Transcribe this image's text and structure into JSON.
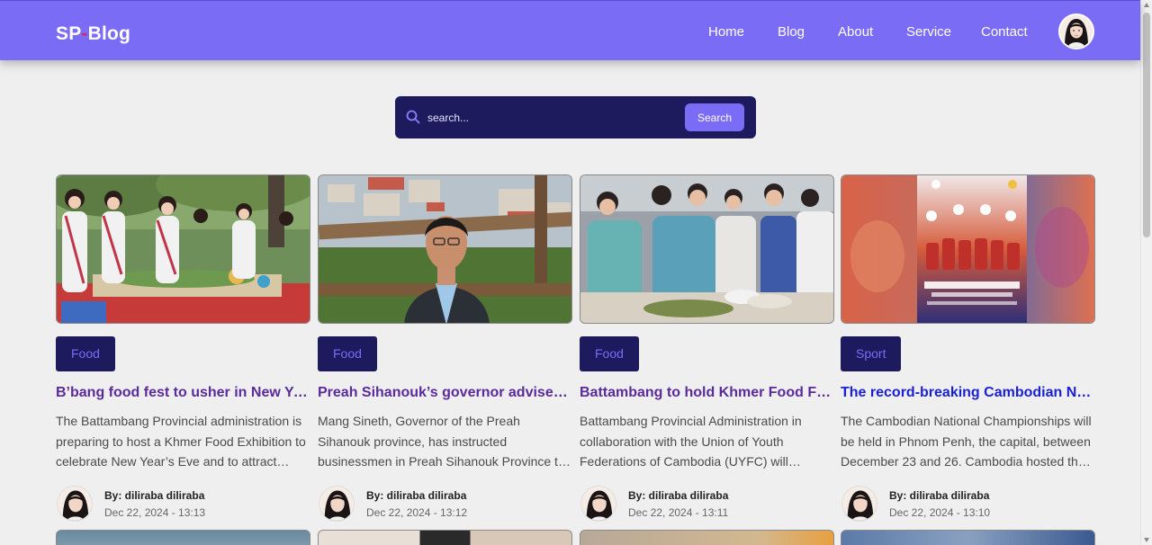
{
  "header": {
    "logo_part1": "SP",
    "logo_dash": "-",
    "logo_part2": "Blog",
    "nav": [
      {
        "label": "Home"
      },
      {
        "label": "Blog"
      },
      {
        "label": "About"
      },
      {
        "label": "Service"
      },
      {
        "label": "Contact"
      }
    ]
  },
  "search": {
    "placeholder": "search...",
    "button_label": "Search"
  },
  "posts": [
    {
      "category": "Food",
      "title": "B’bang food fest to usher in New Year",
      "excerpt": "The Battambang Provincial administration is preparing to host a Khmer Food Exhibition to celebrate New Year’s Eve and to attract tourists to the province.",
      "author": "By: diliraba diliraba",
      "date": "Dec 22, 2024 - 13:13"
    },
    {
      "category": "Food",
      "title": "Preah Sihanouk’s governor advises businessmen",
      "excerpt": "Mang Sineth, Governor of the Preah Sihanouk province, has instructed businessmen in Preah Sihanouk Province to comply with regulations.",
      "author": "By: diliraba diliraba",
      "date": "Dec 22, 2024 - 13:12"
    },
    {
      "category": "Food",
      "title": "Battambang to hold Khmer Food Festival",
      "excerpt": "Battambang Provincial Administration in collaboration with the Union of Youth Federations of Cambodia (UYFC) will organise a Khmer food festival.",
      "author": "By: diliraba diliraba",
      "date": "Dec 22, 2024 - 13:11"
    },
    {
      "category": "Sport",
      "title": "The record-breaking Cambodian National Championships",
      "excerpt": "The Cambodian National Championships will be held in Phnom Penh, the capital, between December 23 and 26. Cambodia hosted the event last year.",
      "author": "By: diliraba diliraba",
      "date": "Dec 22, 2024 - 13:10"
    }
  ],
  "colors": {
    "header": "#7b6cf6",
    "dark_navy": "#1d1a5e",
    "food_title": "#5b2a9b",
    "sport_title": "#1a1fd6",
    "background": "#efefef"
  },
  "icons": {
    "search": "search-icon",
    "avatar": "user-avatar"
  }
}
